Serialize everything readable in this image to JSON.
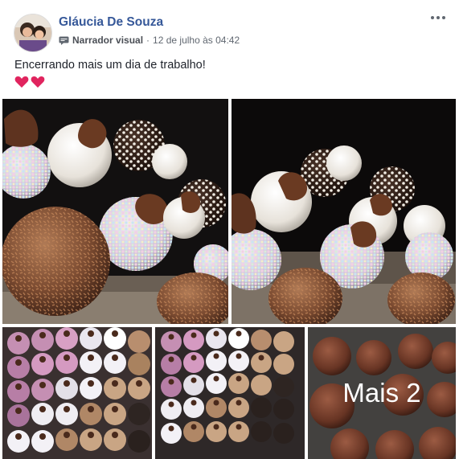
{
  "post": {
    "author": "Gláucia De Souza",
    "source": "Narrador visual",
    "separator": "·",
    "timestamp": "12 de julho às 04:42",
    "text": "Encerrando mais um dia de trabalho!",
    "emoji": "❤️❤️",
    "more_photos_label": "Mais 2"
  },
  "colors": {
    "author_link": "#365899",
    "meta_text": "#606770",
    "body_text": "#1d2129"
  },
  "icons": [
    "more-options-icon",
    "visual-storyteller-icon",
    "heart-emoji-icon"
  ]
}
